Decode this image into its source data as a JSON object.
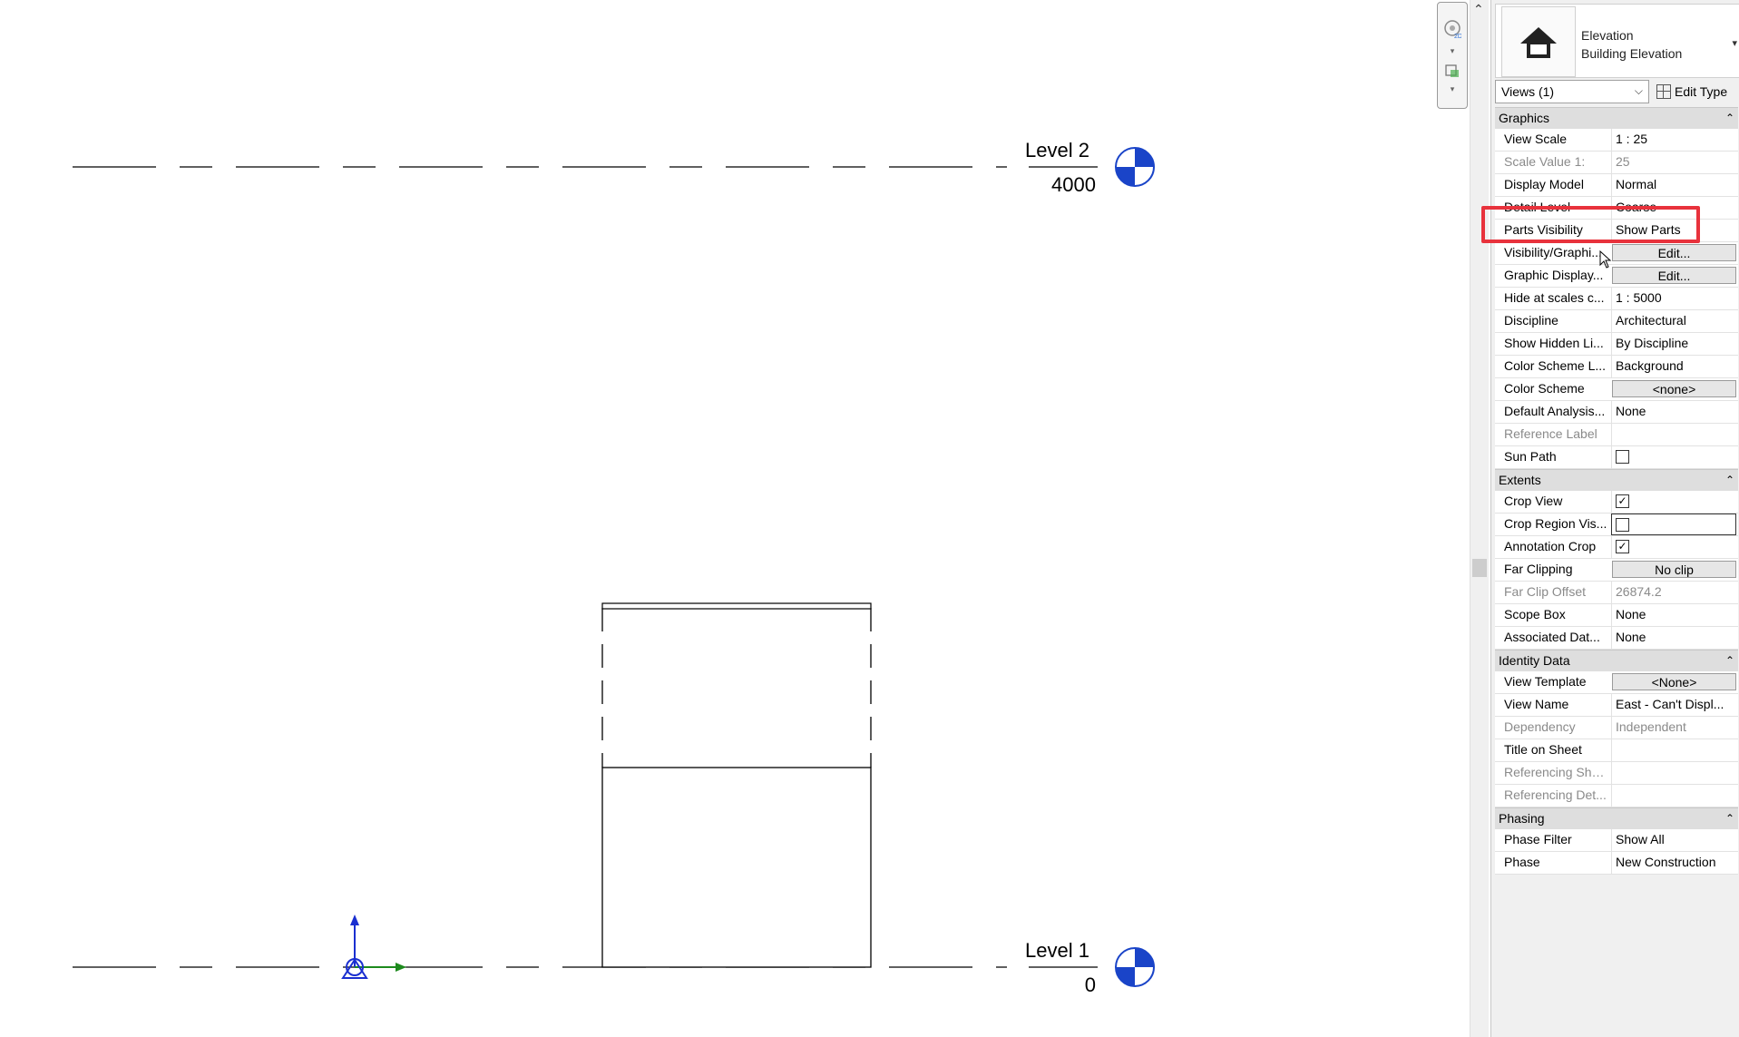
{
  "canvas": {
    "levels": [
      {
        "name": "Level 2",
        "elevation": "4000"
      },
      {
        "name": "Level 1",
        "elevation": "0"
      }
    ]
  },
  "properties": {
    "type_family": "Elevation",
    "type_name": "Building Elevation",
    "views_selector": "Views (1)",
    "edit_type_label": "Edit Type",
    "groups": [
      {
        "title": "Graphics",
        "rows": [
          {
            "label": "View Scale",
            "value": "1 : 25",
            "state": "normal"
          },
          {
            "label": "Scale Value    1:",
            "value": "25",
            "state": "disabled"
          },
          {
            "label": "Display Model",
            "value": "Normal",
            "state": "normal"
          },
          {
            "label": "Detail Level",
            "value": "Coarse",
            "state": "normal"
          },
          {
            "label": "Parts Visibility",
            "value": "Show Parts",
            "state": "normal"
          },
          {
            "label": "Visibility/Graphi...",
            "value": "Edit...",
            "state": "button"
          },
          {
            "label": "Graphic Display...",
            "value": "Edit...",
            "state": "button"
          },
          {
            "label": "Hide at scales c...",
            "value": "1 : 5000",
            "state": "normal"
          },
          {
            "label": "Discipline",
            "value": "Architectural",
            "state": "normal"
          },
          {
            "label": "Show Hidden Li...",
            "value": "By Discipline",
            "state": "normal"
          },
          {
            "label": "Color Scheme L...",
            "value": "Background",
            "state": "normal"
          },
          {
            "label": "Color Scheme",
            "value": "<none>",
            "state": "button"
          },
          {
            "label": "Default Analysis...",
            "value": "None",
            "state": "normal"
          },
          {
            "label": "Reference Label",
            "value": "",
            "state": "disabled"
          },
          {
            "label": "Sun Path",
            "value": "",
            "state": "checkbox",
            "checked": false
          }
        ]
      },
      {
        "title": "Extents",
        "rows": [
          {
            "label": "Crop View",
            "value": "",
            "state": "checkbox",
            "checked": true
          },
          {
            "label": "Crop Region Vis...",
            "value": "",
            "state": "checkbox-boxed",
            "checked": false
          },
          {
            "label": "Annotation Crop",
            "value": "",
            "state": "checkbox",
            "checked": true
          },
          {
            "label": "Far Clipping",
            "value": "No clip",
            "state": "button"
          },
          {
            "label": "Far Clip Offset",
            "value": "26874.2",
            "state": "disabled"
          },
          {
            "label": "Scope Box",
            "value": "None",
            "state": "normal"
          },
          {
            "label": "Associated Dat...",
            "value": "None",
            "state": "normal"
          }
        ]
      },
      {
        "title": "Identity Data",
        "rows": [
          {
            "label": "View Template",
            "value": "<None>",
            "state": "button"
          },
          {
            "label": "View Name",
            "value": "East - Can't Displ...",
            "state": "normal"
          },
          {
            "label": "Dependency",
            "value": "Independent",
            "state": "disabled"
          },
          {
            "label": "Title on Sheet",
            "value": "",
            "state": "normal"
          },
          {
            "label": "Referencing She...",
            "value": "",
            "state": "disabled"
          },
          {
            "label": "Referencing Det...",
            "value": "",
            "state": "disabled"
          }
        ]
      },
      {
        "title": "Phasing",
        "rows": [
          {
            "label": "Phase Filter",
            "value": "Show All",
            "state": "normal"
          },
          {
            "label": "Phase",
            "value": "New Construction",
            "state": "normal"
          }
        ]
      }
    ]
  },
  "icons": {
    "type_thumbnail": "elevation-house-icon",
    "steering_wheel": "steering-wheel-icon",
    "zoom": "zoom-icon",
    "ucs": "ucs-icon",
    "level_head": "level-head-icon"
  },
  "colors": {
    "highlight": "#e8323c",
    "level_head_blue": "#1a44c8",
    "ucs_blue": "#1a2fd0",
    "ucs_green": "#1d8a1d"
  }
}
